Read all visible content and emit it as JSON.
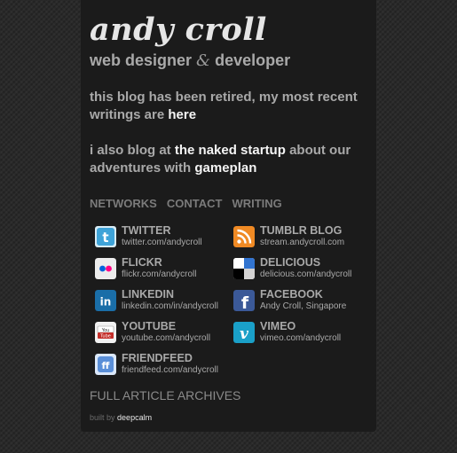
{
  "header": {
    "title": "andy croll",
    "tagline_pre": "web designer",
    "tagline_amp": "&",
    "tagline_post": "developer"
  },
  "intro": {
    "retired_text": "this blog has been retired, my most recent writings are",
    "retired_link": "here",
    "also_pre": "i also blog at",
    "naked_link": "the naked startup",
    "also_mid": "about our adventures with",
    "gameplan_link": "gameplan"
  },
  "nav": [
    "NETWORKS",
    "CONTACT",
    "WRITING"
  ],
  "networks": [
    {
      "name": "TWITTER",
      "url": "twitter.com/andycroll",
      "icon": "twitter-icon",
      "color": "#3ea3d8"
    },
    {
      "name": "TUMBLR BLOG",
      "url": "stream.andycroll.com",
      "icon": "rss-icon",
      "color": "#f08a24"
    },
    {
      "name": "FLICKR",
      "url": "flickr.com/andycroll",
      "icon": "flickr-icon",
      "color": "#e8e8e8"
    },
    {
      "name": "DELICIOUS",
      "url": "delicious.com/andycroll",
      "icon": "delicious-icon",
      "color": "#3274d0"
    },
    {
      "name": "LINKEDIN",
      "url": "linkedin.com/in/andycroll",
      "icon": "linkedin-icon",
      "color": "#1a6ea8"
    },
    {
      "name": "FACEBOOK",
      "url": "Andy Croll, Singapore",
      "icon": "facebook-icon",
      "color": "#3b5998"
    },
    {
      "name": "YOUTUBE",
      "url": "youtube.com/andycroll",
      "icon": "youtube-icon",
      "color": "#c4302b"
    },
    {
      "name": "VIMEO",
      "url": "vimeo.com/andycroll",
      "icon": "vimeo-icon",
      "color": "#1aa0c8"
    },
    {
      "name": "FRIENDFEED",
      "url": "friendfeed.com/andycroll",
      "icon": "friendfeed-icon",
      "color": "#5a8fd8"
    }
  ],
  "footer": {
    "archives": "FULL ARTICLE ARCHIVES",
    "built_by": "built by",
    "brand": "deepcalm"
  }
}
